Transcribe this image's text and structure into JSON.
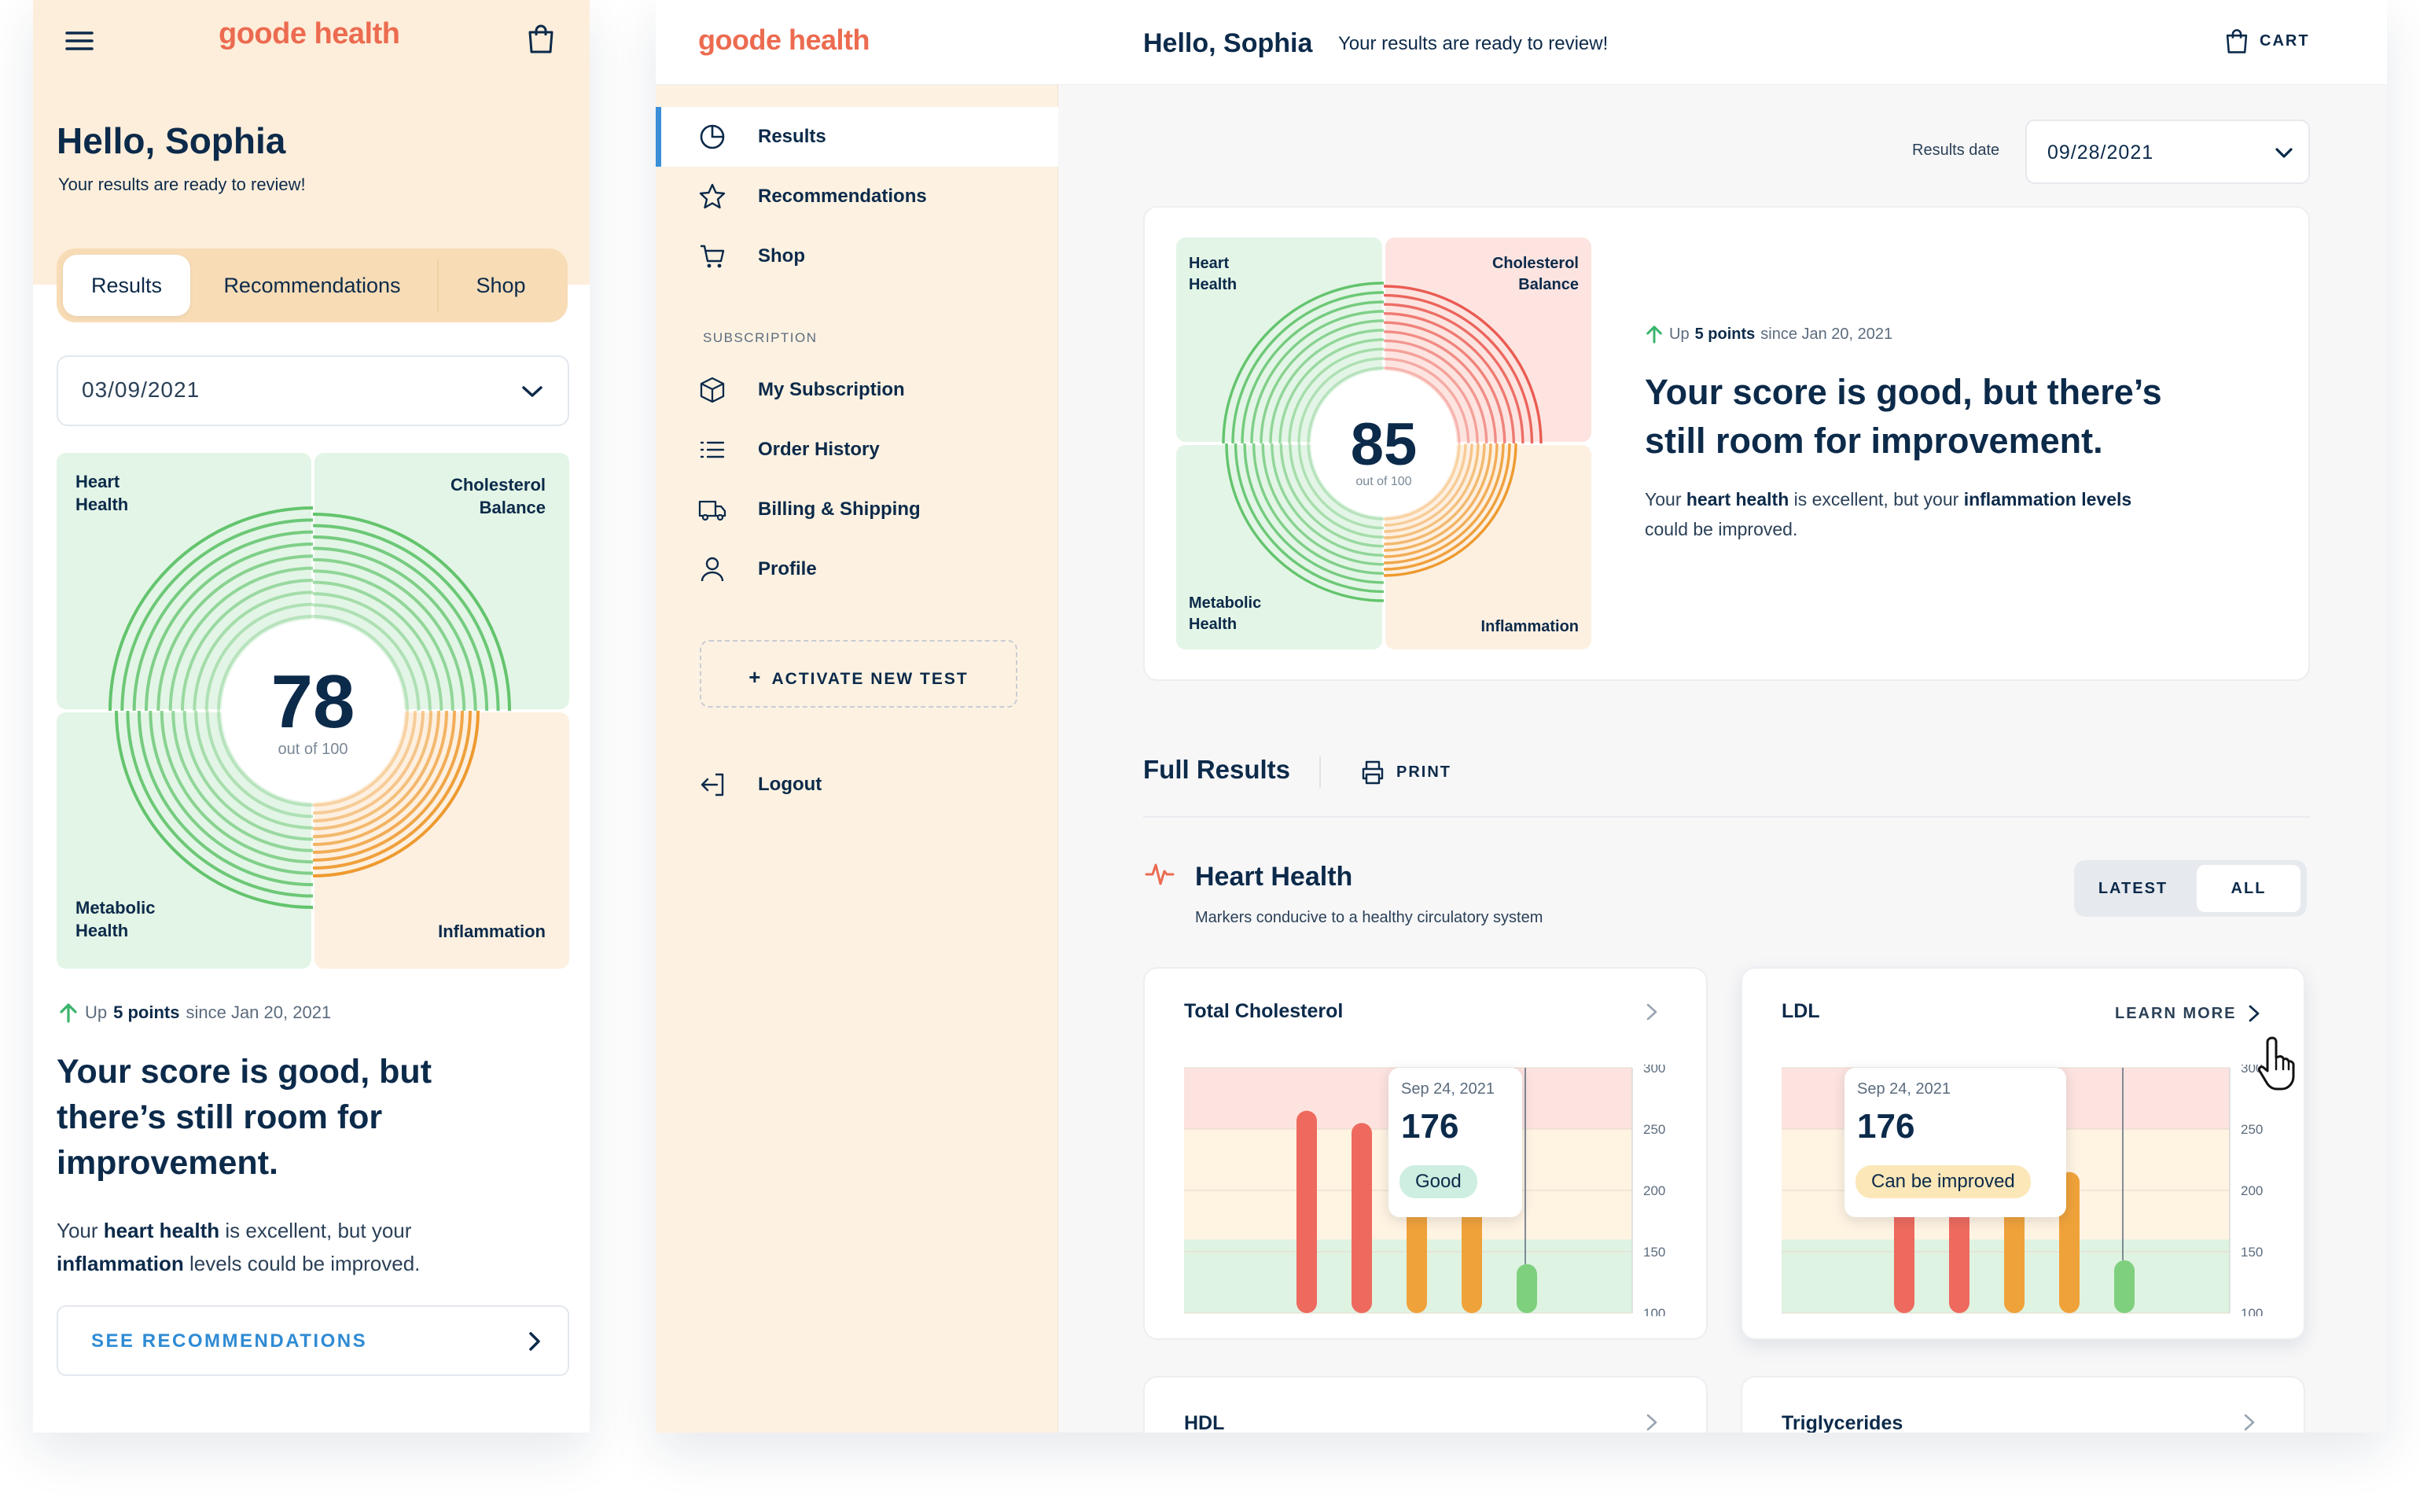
{
  "colors": {
    "brand": "#ec6b50",
    "navy": "#0c2a4a",
    "link_blue": "#2f8bd4",
    "nav_active": "#3b8fd8",
    "sidebar_bg": "#fdf2e2",
    "good_green": "#7ed07e",
    "warn_orange": "#f0a23a",
    "bad_red": "#ee6a5e"
  },
  "brand": {
    "logo": "goode health"
  },
  "mobile": {
    "greeting": "Hello, Sophia",
    "subtitle": "Your results are ready to review!",
    "tabs": [
      "Results",
      "Recommendations",
      "Shop"
    ],
    "active_tab": "Results",
    "date_select": "03/09/2021",
    "score": {
      "value": "78",
      "out_of": "out of 100"
    },
    "quadrants": {
      "heart": "Heart\nHealth",
      "cholesterol": "Cholesterol\nBalance",
      "metabolic": "Metabolic\nHealth",
      "inflammation": "Inflammation"
    },
    "change": {
      "prefix": "Up",
      "points": "5 points",
      "suffix": "since Jan 20, 2021"
    },
    "headline": "Your score is good, but there’s still room for improvement.",
    "body": {
      "p1": "Your",
      "b1": "heart health",
      "p2": "is excellent, but your",
      "b2": "inflammation",
      "p3": "levels could be improved."
    },
    "cta": "SEE RECOMMENDATIONS"
  },
  "desktop": {
    "header": {
      "greeting": "Hello, Sophia",
      "subtitle": "Your results are ready to review!",
      "cart": "CART"
    },
    "sidebar": {
      "items": [
        {
          "label": "Results",
          "icon": "pie-chart-icon"
        },
        {
          "label": "Recommendations",
          "icon": "star-icon"
        },
        {
          "label": "Shop",
          "icon": "cart-icon"
        }
      ],
      "section": "SUBSCRIPTION",
      "sub_items": [
        {
          "label": "My Subscription",
          "icon": "box-icon"
        },
        {
          "label": "Order History",
          "icon": "list-icon"
        },
        {
          "label": "Billing & Shipping",
          "icon": "truck-icon"
        },
        {
          "label": "Profile",
          "icon": "user-icon"
        }
      ],
      "activate": "ACTIVATE NEW TEST",
      "logout": "Logout"
    },
    "results_date": {
      "label": "Results date",
      "value": "09/28/2021"
    },
    "score": {
      "value": "85",
      "out_of": "out of 100"
    },
    "quadrants": {
      "heart": "Heart\nHealth",
      "cholesterol": "Cholesterol\nBalance",
      "metabolic": "Metabolic\nHealth",
      "inflammation": "Inflammation"
    },
    "change": {
      "prefix": "Up",
      "points": "5 points",
      "suffix": "since Jan 20, 2021"
    },
    "headline": "Your score is good, but there’s still room for improvement.",
    "body": {
      "p1": "Your",
      "b1": "heart health",
      "p2": "is excellent, but your",
      "b2": "inflammation levels",
      "p3": "could be improved."
    },
    "full_results": {
      "title": "Full Results",
      "print": "PRINT"
    },
    "section": {
      "title": "Heart Health",
      "subtitle": "Markers conducive to a healthy circulatory system",
      "toggle": [
        "LATEST",
        "ALL"
      ],
      "active_toggle": "ALL"
    },
    "cards": [
      {
        "title": "Total Cholesterol",
        "tooltip_date": "Sep 24, 2021",
        "tooltip_value": "176",
        "status": "Good",
        "status_color": "#cdeee0",
        "y_ticks": [
          "300",
          "250",
          "200",
          "150",
          "100"
        ],
        "bars": [
          {
            "value": 265,
            "level": "red"
          },
          {
            "value": 255,
            "level": "red"
          },
          {
            "value": 192,
            "level": "orange"
          },
          {
            "value": 192,
            "level": "orange"
          },
          {
            "value": 140,
            "level": "green"
          }
        ]
      },
      {
        "title": "LDL",
        "learn_more": "LEARN MORE",
        "tooltip_date": "Sep 24, 2021",
        "tooltip_value": "176",
        "status": "Can be improved",
        "status_color": "#fbe7b8",
        "y_ticks": [
          "300",
          "250",
          "200",
          "150",
          "100"
        ],
        "bars": [
          {
            "value": 192,
            "level": "red"
          },
          {
            "value": 192,
            "level": "red"
          },
          {
            "value": 192,
            "level": "orange"
          },
          {
            "value": 215,
            "level": "orange"
          },
          {
            "value": 143,
            "level": "green"
          }
        ]
      }
    ],
    "more_cards": [
      "HDL",
      "Triglycerides"
    ]
  }
}
